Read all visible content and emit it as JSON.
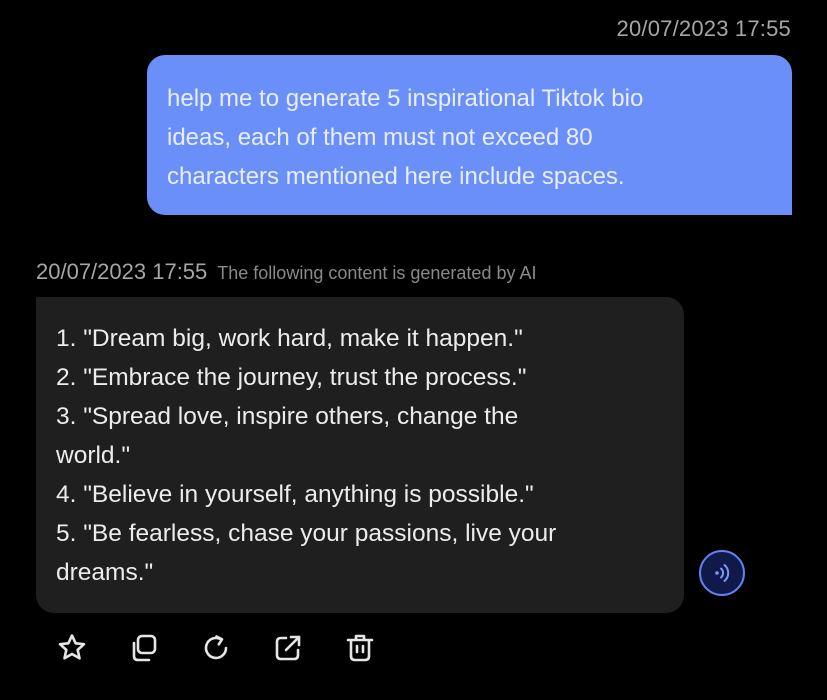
{
  "user_message": {
    "timestamp": "20/07/2023 17:55",
    "text": "help me to generate 5 inspirational Tiktok bio\nideas, each of them must not exceed 80\ncharacters mentioned here include spaces."
  },
  "ai_message": {
    "timestamp": "20/07/2023 17:55",
    "notice": "The following content is generated by AI",
    "lines": [
      "1. \"Dream big, work hard, make it happen.\"",
      "2. \"Embrace the journey, trust the process.\"",
      "3. \"Spread love, inspire others, change the",
      "world.\"",
      "4. \"Believe in yourself, anything is possible.\"",
      "5. \"Be fearless, chase your passions, live your",
      "dreams.\""
    ]
  },
  "actions": [
    {
      "name": "favorite-button",
      "icon": "star-icon"
    },
    {
      "name": "copy-button",
      "icon": "copy-icon"
    },
    {
      "name": "regenerate-button",
      "icon": "refresh-icon"
    },
    {
      "name": "share-button",
      "icon": "share-icon"
    },
    {
      "name": "delete-button",
      "icon": "trash-icon"
    }
  ],
  "speak_button": {
    "icon": "speaker-icon"
  },
  "colors": {
    "background": "#000000",
    "user_bubble": "#6b8ff8",
    "ai_bubble": "#1f1f1f",
    "accent": "#5f83f0",
    "timestamp": "#a6a6a6"
  }
}
